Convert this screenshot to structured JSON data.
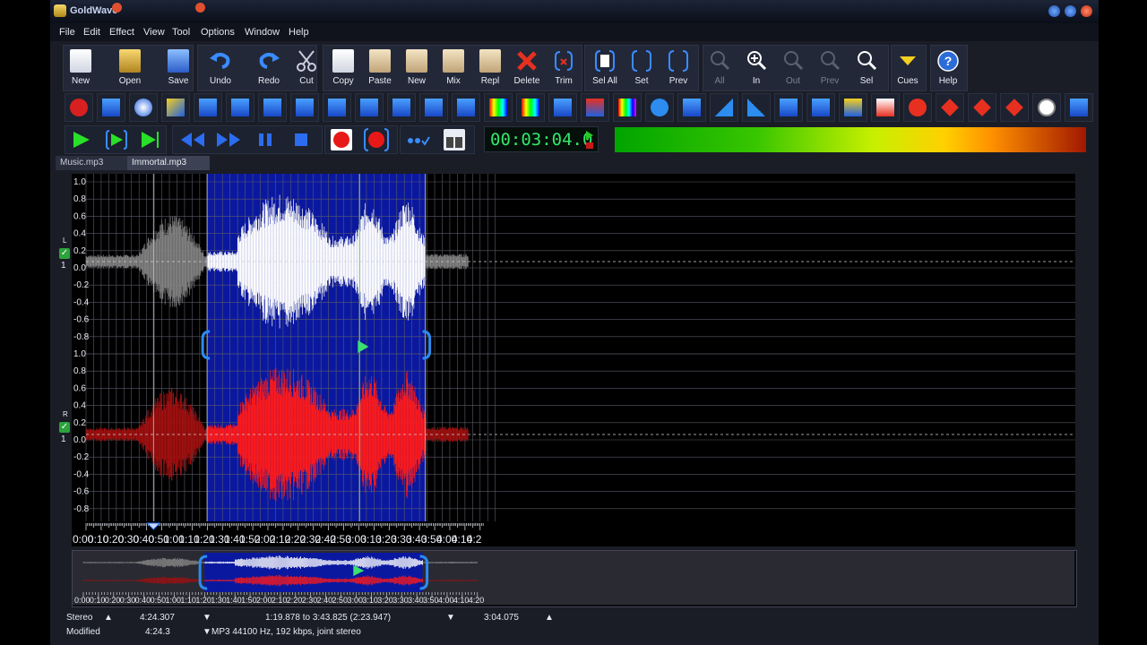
{
  "window": {
    "title": "GoldWave"
  },
  "menu": [
    "File",
    "Edit",
    "Effect",
    "View",
    "Tool",
    "Options",
    "Window",
    "Help"
  ],
  "toolbar": [
    {
      "key": "new",
      "label": "New"
    },
    {
      "key": "open",
      "label": "Open"
    },
    {
      "key": "save",
      "label": "Save"
    },
    {
      "key": "undo",
      "label": "Undo"
    },
    {
      "key": "redo",
      "label": "Redo"
    },
    {
      "key": "cut",
      "label": "Cut"
    },
    {
      "key": "copy",
      "label": "Copy"
    },
    {
      "key": "paste",
      "label": "Paste"
    },
    {
      "key": "new2",
      "label": "New"
    },
    {
      "key": "mix",
      "label": "Mix"
    },
    {
      "key": "repl",
      "label": "Repl"
    },
    {
      "key": "delete",
      "label": "Delete"
    },
    {
      "key": "trim",
      "label": "Trim"
    },
    {
      "key": "selall",
      "label": "Sel All"
    },
    {
      "key": "set",
      "label": "Set"
    },
    {
      "key": "prev",
      "label": "Prev"
    },
    {
      "key": "all",
      "label": "All"
    },
    {
      "key": "zoomin",
      "label": "In"
    },
    {
      "key": "zoomout",
      "label": "Out"
    },
    {
      "key": "zoomprev",
      "label": "Prev"
    },
    {
      "key": "zoomsel",
      "label": "Sel"
    },
    {
      "key": "cues",
      "label": "Cues"
    },
    {
      "key": "help",
      "label": "Help"
    }
  ],
  "transport": {
    "time": "00:03:04.0"
  },
  "tabs": [
    {
      "label": "Music.mp3",
      "active": false
    },
    {
      "label": "Immortal.mp3",
      "active": true
    }
  ],
  "channels": [
    {
      "letter": "L",
      "number": "1",
      "color": "#ffffff"
    },
    {
      "letter": "R",
      "number": "1",
      "color": "#ff1a1a"
    }
  ],
  "amplitude_labels": [
    "1.0",
    "0.8",
    "0.6",
    "0.4",
    "0.2",
    "0.0",
    "-0.2",
    "-0.4",
    "-0.6",
    "-0.8"
  ],
  "timeline_labels": [
    "0:00",
    "0:10",
    "0:20",
    "0:30",
    "0:40",
    "0:50",
    "1:00",
    "1:10",
    "1:20",
    "1:30",
    "1:40",
    "1:50",
    "2:00",
    "2:10",
    "2:20",
    "2:30",
    "2:40",
    "2:50",
    "3:00",
    "3:10",
    "3:20",
    "3:30",
    "3:40",
    "3:50",
    "4:00",
    "4:10",
    "4:2"
  ],
  "overview_labels": [
    "0:00",
    "0:10",
    "0:20",
    "0:30",
    "0:40",
    "0:50",
    "1:00",
    "1:10",
    "1:20",
    "1:30",
    "1:40",
    "1:50",
    "2:00",
    "2:10",
    "2:20",
    "2:30",
    "2:40",
    "2:50",
    "3:00",
    "3:10",
    "3:20",
    "3:30",
    "3:40",
    "3:50",
    "4:00",
    "4:10",
    "4:20"
  ],
  "selection": {
    "start_sec": 79.878,
    "end_sec": 223.825,
    "marker_sec": 44.5,
    "playhead_sec": 180.5,
    "total_sec": 264.307
  },
  "status": {
    "channels": "Stereo",
    "duration": "4:24.307",
    "selection": "1:19.878 to 3:43.825 (2:23.947)",
    "position": "3:04.075",
    "modified": "Modified",
    "size": "4:24.3",
    "format": "MP3 44100 Hz, 192 kbps, joint stereo"
  },
  "colors": {
    "selection": "#0a18a0",
    "left": "#ffffff",
    "right": "#ff1a1a",
    "accent": "#32e86a"
  }
}
